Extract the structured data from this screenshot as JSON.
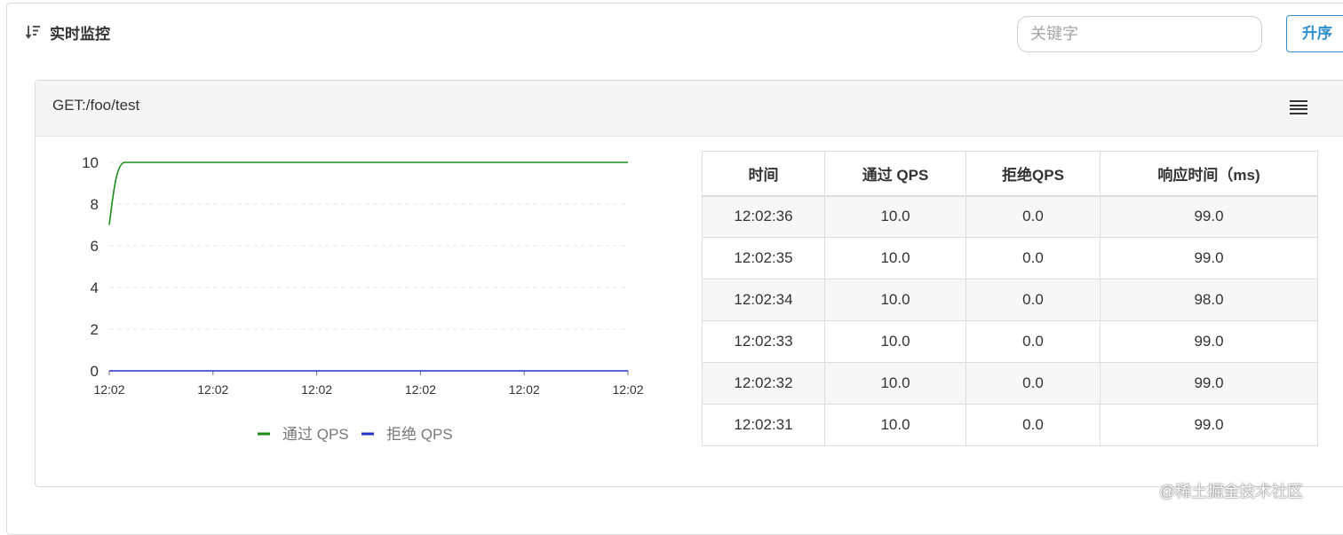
{
  "header": {
    "title": "实时监控",
    "sort_icon": "sort-descending-icon",
    "search_placeholder": "关键字",
    "asc_button": "升序"
  },
  "panel": {
    "title": "GET:/foo/test",
    "menu_icon": "hamburger-menu-icon"
  },
  "chart_data": {
    "type": "line",
    "x": [
      "12:02",
      "12:02",
      "12:02",
      "12:02",
      "12:02",
      "12:02"
    ],
    "ylim": [
      0,
      10
    ],
    "yticks": [
      0,
      2,
      4,
      6,
      8,
      10
    ],
    "grid": true,
    "legend_position": "bottom",
    "series": [
      {
        "name": "通过 QPS",
        "color": "#1a8c1a",
        "points": [
          [
            0,
            7
          ],
          [
            0.15,
            10
          ],
          [
            5,
            10
          ]
        ]
      },
      {
        "name": "拒绝 QPS",
        "color": "#2233cc",
        "points": [
          [
            0,
            0
          ],
          [
            5,
            0
          ]
        ]
      }
    ]
  },
  "table": {
    "headers": [
      "时间",
      "通过 QPS",
      "拒绝QPS",
      "响应时间（ms)"
    ],
    "rows": [
      [
        "12:02:36",
        "10.0",
        "0.0",
        "99.0"
      ],
      [
        "12:02:35",
        "10.0",
        "0.0",
        "99.0"
      ],
      [
        "12:02:34",
        "10.0",
        "0.0",
        "98.0"
      ],
      [
        "12:02:33",
        "10.0",
        "0.0",
        "99.0"
      ],
      [
        "12:02:32",
        "10.0",
        "0.0",
        "99.0"
      ],
      [
        "12:02:31",
        "10.0",
        "0.0",
        "99.0"
      ]
    ]
  },
  "watermark": "@稀土掘金技术社区"
}
